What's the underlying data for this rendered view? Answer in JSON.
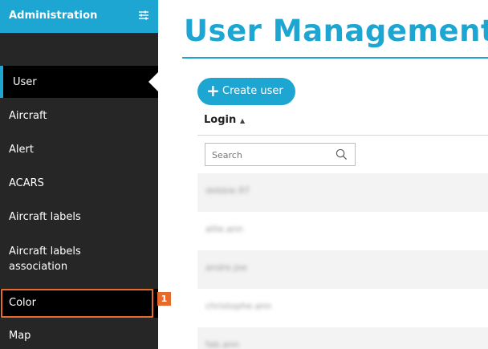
{
  "sidebar": {
    "title": "Administration",
    "filter_icon": "sliders-icon",
    "items": [
      {
        "label": "User",
        "active": true
      },
      {
        "label": "Aircraft"
      },
      {
        "label": "Alert"
      },
      {
        "label": "ACARS"
      },
      {
        "label": "Aircraft labels"
      },
      {
        "label": "Aircraft labels association"
      },
      {
        "label": "Color",
        "highlighted": true
      },
      {
        "label": "Map"
      }
    ]
  },
  "annotation": {
    "badge": "1",
    "color": "#e66a2c"
  },
  "main": {
    "title": "User Management",
    "create_button": "Create user",
    "columns": [
      {
        "label": "Login",
        "sort": "ascending"
      }
    ],
    "search": {
      "placeholder": "Search",
      "value": ""
    },
    "rows": [
      {
        "login": "debbie.97"
      },
      {
        "login": "allie.ann"
      },
      {
        "login": "andre.joe"
      },
      {
        "login": "christophe.ann"
      },
      {
        "login": "fab.ann"
      }
    ]
  },
  "colors": {
    "accent": "#1ea6d3",
    "sidebar_bg": "#262626",
    "highlight": "#e66a2c"
  }
}
